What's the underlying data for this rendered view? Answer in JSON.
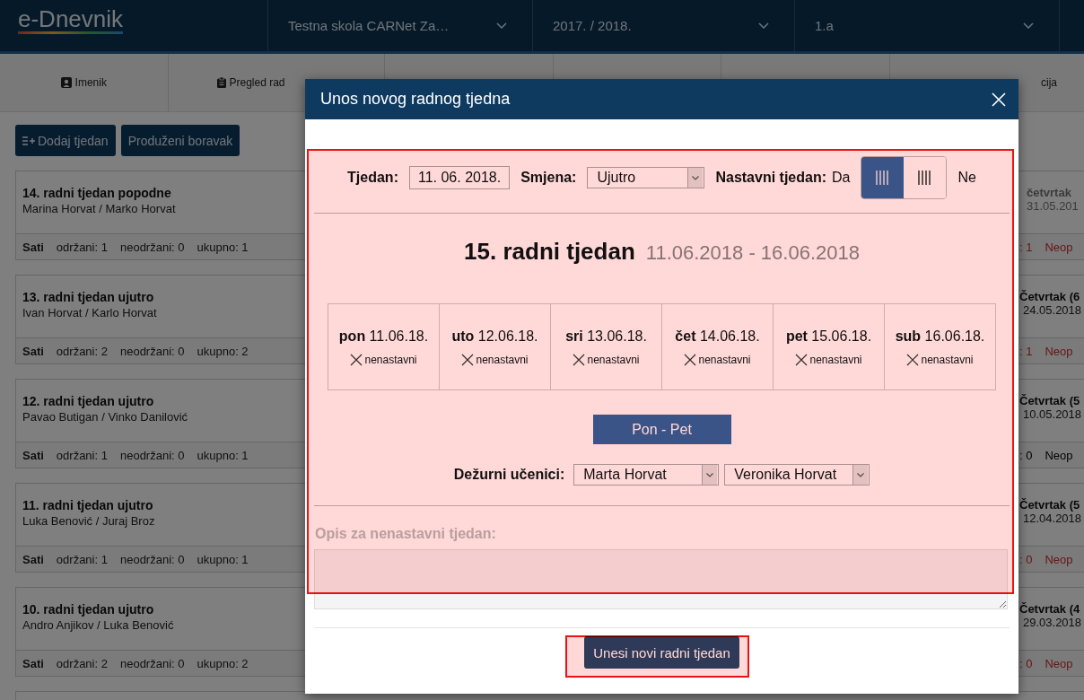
{
  "app": {
    "logo": "e-Dnevnik",
    "selectors": [
      {
        "value": "Testna skola CARNet Za…"
      },
      {
        "value": "2017. / 2018."
      },
      {
        "value": "1.a"
      }
    ]
  },
  "nav_tabs": [
    {
      "kind": "label",
      "label": "Imenik"
    },
    {
      "kind": "label",
      "label": "Pregled rad"
    },
    {
      "kind": "covered"
    },
    {
      "kind": "covered"
    },
    {
      "kind": "covered"
    },
    {
      "kind": "label",
      "label": "cija"
    }
  ],
  "toolbar": {
    "add_button": "Dodaj tjedan",
    "extended_button": "Produženi boravak"
  },
  "weeks": [
    {
      "title": "14. radni tjedan popodne",
      "names": "Marina Horvat / Marko Horvat",
      "hours_label": "Sati",
      "held": "održani: 1",
      "not_held": "neodržani: 0",
      "total": "ukupno: 1",
      "right_title": "četvrtak",
      "right_muted": true,
      "right_date": "31.05.201",
      "right_count": ": 1",
      "right_status": "Neop",
      "alert": true
    },
    {
      "title": "13. radni tjedan ujutro",
      "names": "Ivan Horvat / Karlo Horvat",
      "hours_label": "Sati",
      "held": "održani: 2",
      "not_held": "neodržani: 0",
      "total": "ukupno: 2",
      "right_title": "Četvrtak (6",
      "right_muted": false,
      "right_date": "24.05.2018",
      "right_count": ": 1",
      "right_status": "Neop",
      "alert": true
    },
    {
      "title": "12. radni tjedan ujutro",
      "names": "Pavao Butigan / Vinko Danilović",
      "hours_label": "Sati",
      "held": "održani: 1",
      "not_held": "neodržani: 0",
      "total": "ukupno: 1",
      "right_title": "Četvrtak (5",
      "right_muted": false,
      "right_date": "10.05.2018",
      "right_count": ": 0",
      "right_status": "Neop",
      "alert": false
    },
    {
      "title": "11. radni tjedan ujutro",
      "names": "Luka Benović / Juraj Broz",
      "hours_label": "Sati",
      "held": "održani: 1",
      "not_held": "neodržani: 0",
      "total": "ukupno: 1",
      "right_title": "Četvrtak (5",
      "right_muted": false,
      "right_date": "12.04.2018",
      "right_count": ": 0",
      "right_status": "Neop",
      "alert": true
    },
    {
      "title": "10. radni tjedan ujutro",
      "names": "Andro Anjikov / Luka Benović",
      "hours_label": "Sati",
      "held": "održani: 2",
      "not_held": "neodržani: 0",
      "total": "ukupno: 2",
      "right_title": "Četvrtak (4",
      "right_muted": false,
      "right_date": "29.03.2018",
      "right_count": ": 0",
      "right_status": "Neop",
      "alert": true
    }
  ],
  "modal": {
    "title": "Unos novog radnog tjedna",
    "week_label": "Tjedan:",
    "week_value": "11. 06. 2018.",
    "shift_label": "Smjena:",
    "shift_value": "Ujutro",
    "teaching_label": "Nastavni tjedan:",
    "yes_label": "Da",
    "toggle": [
      {
        "selected": true
      },
      {
        "selected": false
      }
    ],
    "no_label": "Ne",
    "heading": "15. radni tjedan",
    "range": "11.06.2018 - 16.06.2018",
    "days": [
      {
        "day": "pon",
        "date": "11.06.18.",
        "status": "nenastavni"
      },
      {
        "day": "uto",
        "date": "12.06.18.",
        "status": "nenastavni"
      },
      {
        "day": "sri",
        "date": "13.06.18.",
        "status": "nenastavni"
      },
      {
        "day": "čet",
        "date": "14.06.18.",
        "status": "nenastavni"
      },
      {
        "day": "pet",
        "date": "15.06.18.",
        "status": "nenastavni"
      },
      {
        "day": "sub",
        "date": "16.06.18.",
        "status": "nenastavni"
      }
    ],
    "range_button": "Pon - Pet",
    "duty_label": "Dežurni učenici:",
    "duty_students": [
      "Marta Horvat",
      "Veronika Horvat"
    ],
    "description_label": "Opis za nenastavni tjedan:",
    "description_disabled": true,
    "submit": "Unesi novi radni tjedan"
  }
}
